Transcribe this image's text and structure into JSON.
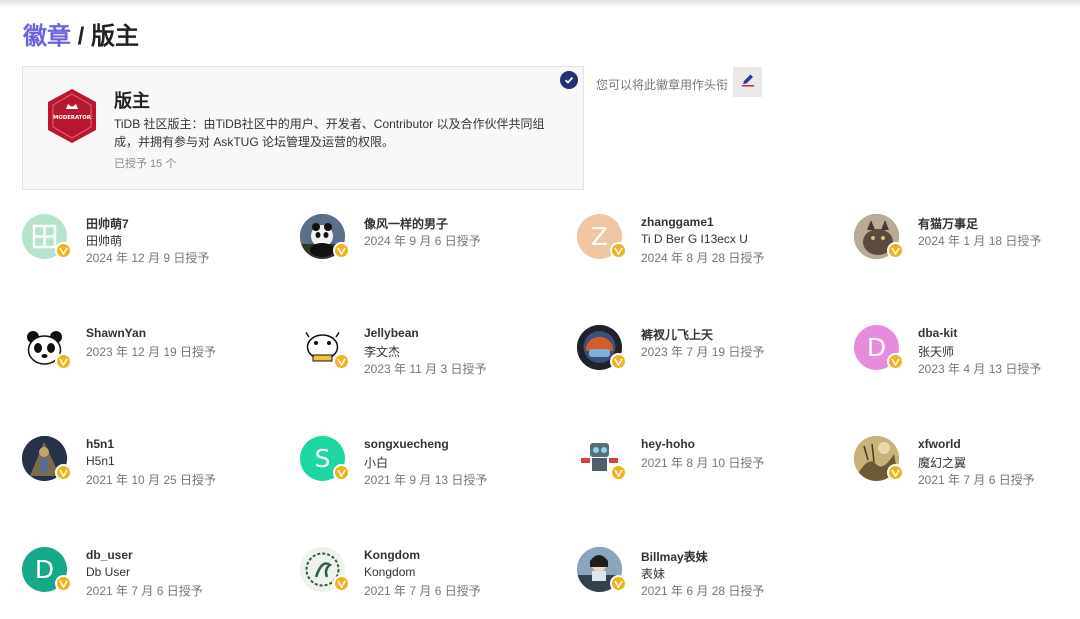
{
  "breadcrumb": {
    "badges_link": "徽章",
    "separator": "/",
    "current": "版主"
  },
  "badge": {
    "title": "版主",
    "description": "TiDB 社区版主：由TiDB社区中的用户、开发者、Contributor 以及合作伙伴共同组成，并拥有参与对 AskTUG 论坛管理及运营的权限。",
    "granted_count": "已授予 15 个",
    "logo_text": "MODERATOR",
    "logo_color": "#b8172f",
    "icons": {
      "logo": "moderator-badge-icon",
      "selected": "check-icon",
      "edit": "pencil-icon"
    }
  },
  "avatar_hint": "您可以将此徽章用作头衔",
  "grantees": [
    {
      "username": "田帅萌7",
      "name": "田帅萌",
      "date": "2024 年 12 月 9 日授予",
      "avatar_type": "grid-avatar",
      "avatar_color": "#b5e3cc"
    },
    {
      "username": "像风一样的男子",
      "name": "",
      "date": "2024 年 9 月 6 日授予",
      "avatar_type": "panda-photo-avatar",
      "avatar_color": "#3b4a5c"
    },
    {
      "username": "zhanggame1",
      "name": "Ti D Ber G I13ecx U",
      "date": "2024 年 8 月 28 日授予",
      "avatar_type": "letter-avatar",
      "initial": "Z",
      "avatar_color": "#efc5a3"
    },
    {
      "username": "有猫万事足",
      "name": "",
      "date": "2024 年 1 月 18 日授予",
      "avatar_type": "cat-photo-avatar",
      "avatar_color": "#6e5f52"
    },
    {
      "username": "ShawnYan",
      "name": "",
      "date": "2023 年 12 月 19 日授予",
      "avatar_type": "panda-cartoon-avatar",
      "avatar_color": "#ffffff"
    },
    {
      "username": "Jellybean",
      "name": "李文杰",
      "date": "2023 年 11 月 3 日授予",
      "avatar_type": "cow-cartoon-avatar",
      "avatar_color": "#ffffff"
    },
    {
      "username": "裤衩儿飞上天",
      "name": "",
      "date": "2023 年 7 月 19 日授予",
      "avatar_type": "helmet-photo-avatar",
      "avatar_color": "#2b2f36"
    },
    {
      "username": "dba-kit",
      "name": "张天师",
      "date": "2023 年 4 月 13 日授予",
      "avatar_type": "letter-avatar",
      "initial": "D",
      "avatar_color": "#e58ddc"
    },
    {
      "username": "h5n1",
      "name": "H5n1",
      "date": "2021 年 10 月 25 日授予",
      "avatar_type": "game-photo-avatar",
      "avatar_color": "#3c4b63"
    },
    {
      "username": "songxuecheng",
      "name": "小白",
      "date": "2021 年 9 月 13 日授予",
      "avatar_type": "letter-avatar",
      "initial": "S",
      "avatar_color": "#1ed6a2"
    },
    {
      "username": "hey-hoho",
      "name": "",
      "date": "2021 年 8 月 10 日授予",
      "avatar_type": "robot-avatar",
      "avatar_color": "#ffffff"
    },
    {
      "username": "xfworld",
      "name": "魔幻之翼",
      "date": "2021 年 7 月 6 日授予",
      "avatar_type": "painting-avatar",
      "avatar_color": "#a08a55"
    },
    {
      "username": "db_user",
      "name": "Db User",
      "date": "2021 年 7 月 6 日授予",
      "avatar_type": "letter-avatar",
      "initial": "D",
      "avatar_color": "#17a889"
    },
    {
      "username": "Kongdom",
      "name": "Kongdom",
      "date": "2021 年 7 月 6 日授予",
      "avatar_type": "emblem-avatar",
      "avatar_color": "#eef2ea"
    },
    {
      "username": "Billmay表妹",
      "name": "表妹",
      "date": "2021 年 6 月 28 日授予",
      "avatar_type": "car-photo-avatar",
      "avatar_color": "#455a6e"
    }
  ]
}
